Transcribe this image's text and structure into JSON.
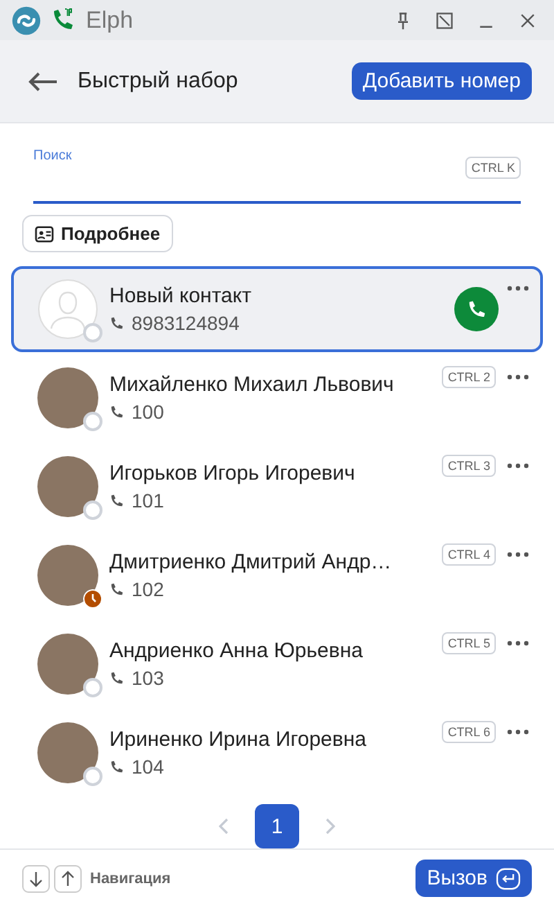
{
  "window": {
    "title": "Elph"
  },
  "header": {
    "title": "Быстрый набор",
    "add_button": "Добавить номер"
  },
  "search": {
    "label": "Поиск",
    "hotkey": "CTRL K"
  },
  "details_button": "Подробнее",
  "contacts": [
    {
      "name": "Новый контакт",
      "number": "8983124894",
      "has_photo": false,
      "away": false,
      "selected": true
    },
    {
      "name": "Михайленко Михаил Львович",
      "number": "100",
      "has_photo": true,
      "away": false,
      "hotkey": "CTRL 2",
      "selected": false
    },
    {
      "name": "Игорьков Игорь Игоревич",
      "number": "101",
      "has_photo": true,
      "away": false,
      "hotkey": "CTRL 3",
      "selected": false
    },
    {
      "name": "Дмитриенко Дмитрий Андр…",
      "number": "102",
      "has_photo": true,
      "away": true,
      "hotkey": "CTRL 4",
      "selected": false
    },
    {
      "name": "Андриенко Анна Юрьевна",
      "number": "103",
      "has_photo": true,
      "away": false,
      "hotkey": "CTRL 5",
      "selected": false
    },
    {
      "name": "Ириненко Ирина Игоревна",
      "number": "104",
      "has_photo": true,
      "away": false,
      "hotkey": "CTRL 6",
      "selected": false
    }
  ],
  "pagination": {
    "pages": [
      {
        "label": "1",
        "selected": true
      }
    ]
  },
  "footer": {
    "hint": "Навигация",
    "call_button": "Вызов"
  }
}
